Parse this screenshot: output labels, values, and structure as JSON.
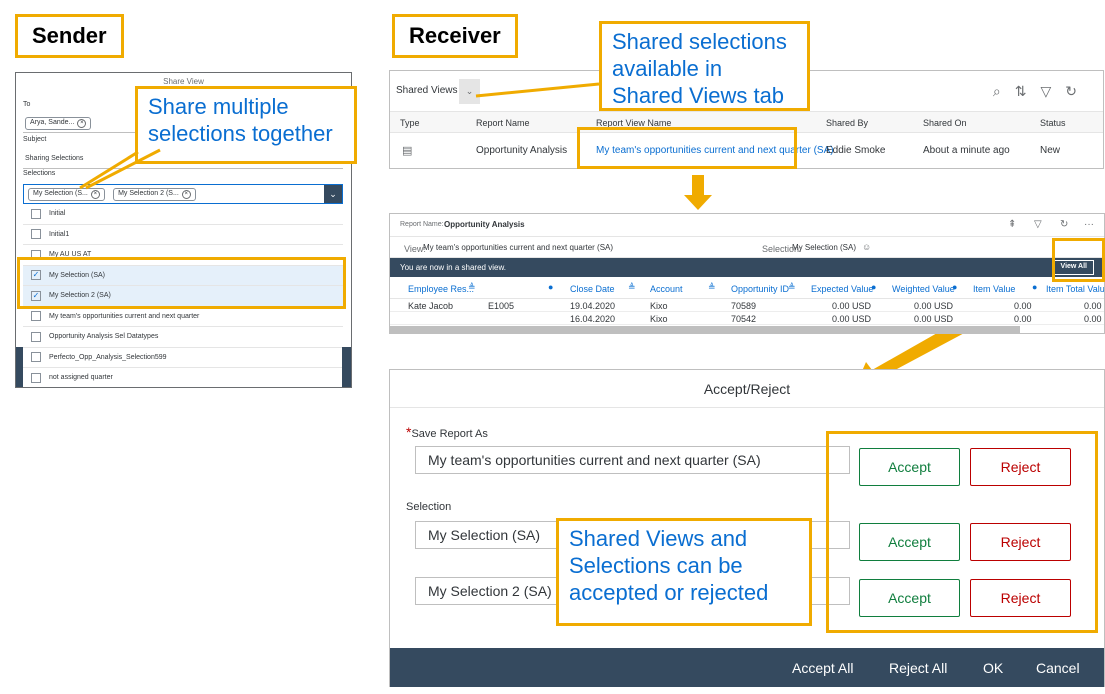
{
  "sections": {
    "sender": "Sender",
    "receiver": "Receiver"
  },
  "callouts": {
    "multiple": "Share multiple selections together",
    "shared_tab": "Shared selections available in Shared Views tab",
    "accept_reject": "Shared Views and Selections can be accepted or rejected"
  },
  "sender_dialog": {
    "title": "Share View",
    "to_label": "To",
    "to_token": "Arya, Sande...",
    "subject_label": "Subject",
    "subject_value": "Sharing Selections",
    "selections_label": "Selections",
    "selection_tokens": [
      "My Selection (S...",
      "My Selection 2 (S..."
    ],
    "items": [
      {
        "label": "Initial",
        "checked": false
      },
      {
        "label": "Initial1",
        "checked": false
      },
      {
        "label": "My AU US AT",
        "checked": false
      },
      {
        "label": "My Selection (SA)",
        "checked": true
      },
      {
        "label": "My Selection 2 (SA)",
        "checked": true
      },
      {
        "label": "My team's opportunities current and next quarter",
        "checked": false
      },
      {
        "label": "Opportunity Analysis Sel Datatypes",
        "checked": false
      },
      {
        "label": "Perfecto_Opp_Analysis_Selection599",
        "checked": false
      },
      {
        "label": "not assigned quarter",
        "checked": false
      }
    ]
  },
  "receiver_table": {
    "title": "Shared Views (1)",
    "columns": [
      "Type",
      "Report Name",
      "Report View Name",
      "Shared By",
      "Shared On",
      "Status"
    ],
    "row": {
      "report_name": "Opportunity Analysis",
      "report_view_name": "My team's opportunities current and next quarter (SA)",
      "shared_by": "Eddie Smoke",
      "shared_on": "About a minute ago",
      "status": "New"
    }
  },
  "analysis": {
    "report_label": "Report Name:",
    "report_name": "Opportunity Analysis",
    "view_label": "View:",
    "view_name": "My team's opportunities current and next quarter (SA)",
    "selection_label": "Selection:",
    "selection_name": "My Selection (SA)",
    "banner": "You are now in a shared view.",
    "view_all": "View All",
    "columns": [
      "Employee Res...",
      "Close Date",
      "Account",
      "Opportunity ID",
      "Expected Value",
      "Weighted Value",
      "Item Value",
      "Item Total Value"
    ],
    "rows": [
      {
        "employee": "Kate Jacob",
        "emp_id": "E1005",
        "close": "19.04.2020",
        "account": "Kixo",
        "opp": "70589",
        "expected": "0.00 USD",
        "weighted": "0.00 USD",
        "item": "0.00",
        "total": "0.00"
      },
      {
        "employee": "",
        "emp_id": "",
        "close": "16.04.2020",
        "account": "Kixo",
        "opp": "70542",
        "expected": "0.00 USD",
        "weighted": "0.00 USD",
        "item": "0.00",
        "total": "0.00"
      }
    ]
  },
  "accept_dialog": {
    "title": "Accept/Reject",
    "required_mark": "*",
    "save_label": "Save Report As",
    "save_value": "My team's opportunities current and next quarter (SA)",
    "selection_label": "Selection",
    "selections": [
      "My Selection (SA)",
      "My Selection 2 (SA)"
    ],
    "accept": "Accept",
    "reject": "Reject",
    "footer": {
      "accept_all": "Accept All",
      "reject_all": "Reject All",
      "ok": "OK",
      "cancel": "Cancel"
    }
  },
  "colors": {
    "highlight": "#f0ab00",
    "link": "#0a6ed1",
    "shell": "#354a5f",
    "accept": "#107e3e",
    "reject": "#bb0000"
  }
}
